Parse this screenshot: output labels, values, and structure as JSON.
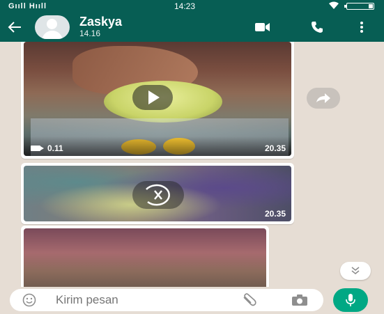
{
  "status_bar": {
    "carrier": "Gııll Hııll",
    "time": "14:23",
    "wifi_icon": "wifi-icon",
    "battery_icon": "battery-icon"
  },
  "header": {
    "back_icon": "arrow-left-icon",
    "avatar_icon": "default-avatar-icon",
    "contact_name": "Zaskya",
    "last_seen": "14.16",
    "actions": [
      "video-call-icon",
      "phone-icon",
      "more-vertical-icon"
    ],
    "bg_color": "#075e54"
  },
  "messages": [
    {
      "type": "video",
      "state": "downloaded",
      "duration": "0.11",
      "time": "20.35",
      "overlay_icon": "play-icon"
    },
    {
      "type": "video",
      "state": "downloading",
      "time": "20.35",
      "overlay_icon": "cancel-download-icon"
    },
    {
      "type": "video",
      "state": "partial-visible"
    }
  ],
  "side_actions": {
    "forward_icon": "forward-icon",
    "scroll_down_icon": "double-chevron-down-icon"
  },
  "input_bar": {
    "emoji_icon": "emoji-icon",
    "placeholder": "Kirim pesan",
    "attach_icon": "paperclip-icon",
    "camera_icon": "camera-icon",
    "mic_icon": "mic-icon",
    "accent_color": "#00a884"
  }
}
